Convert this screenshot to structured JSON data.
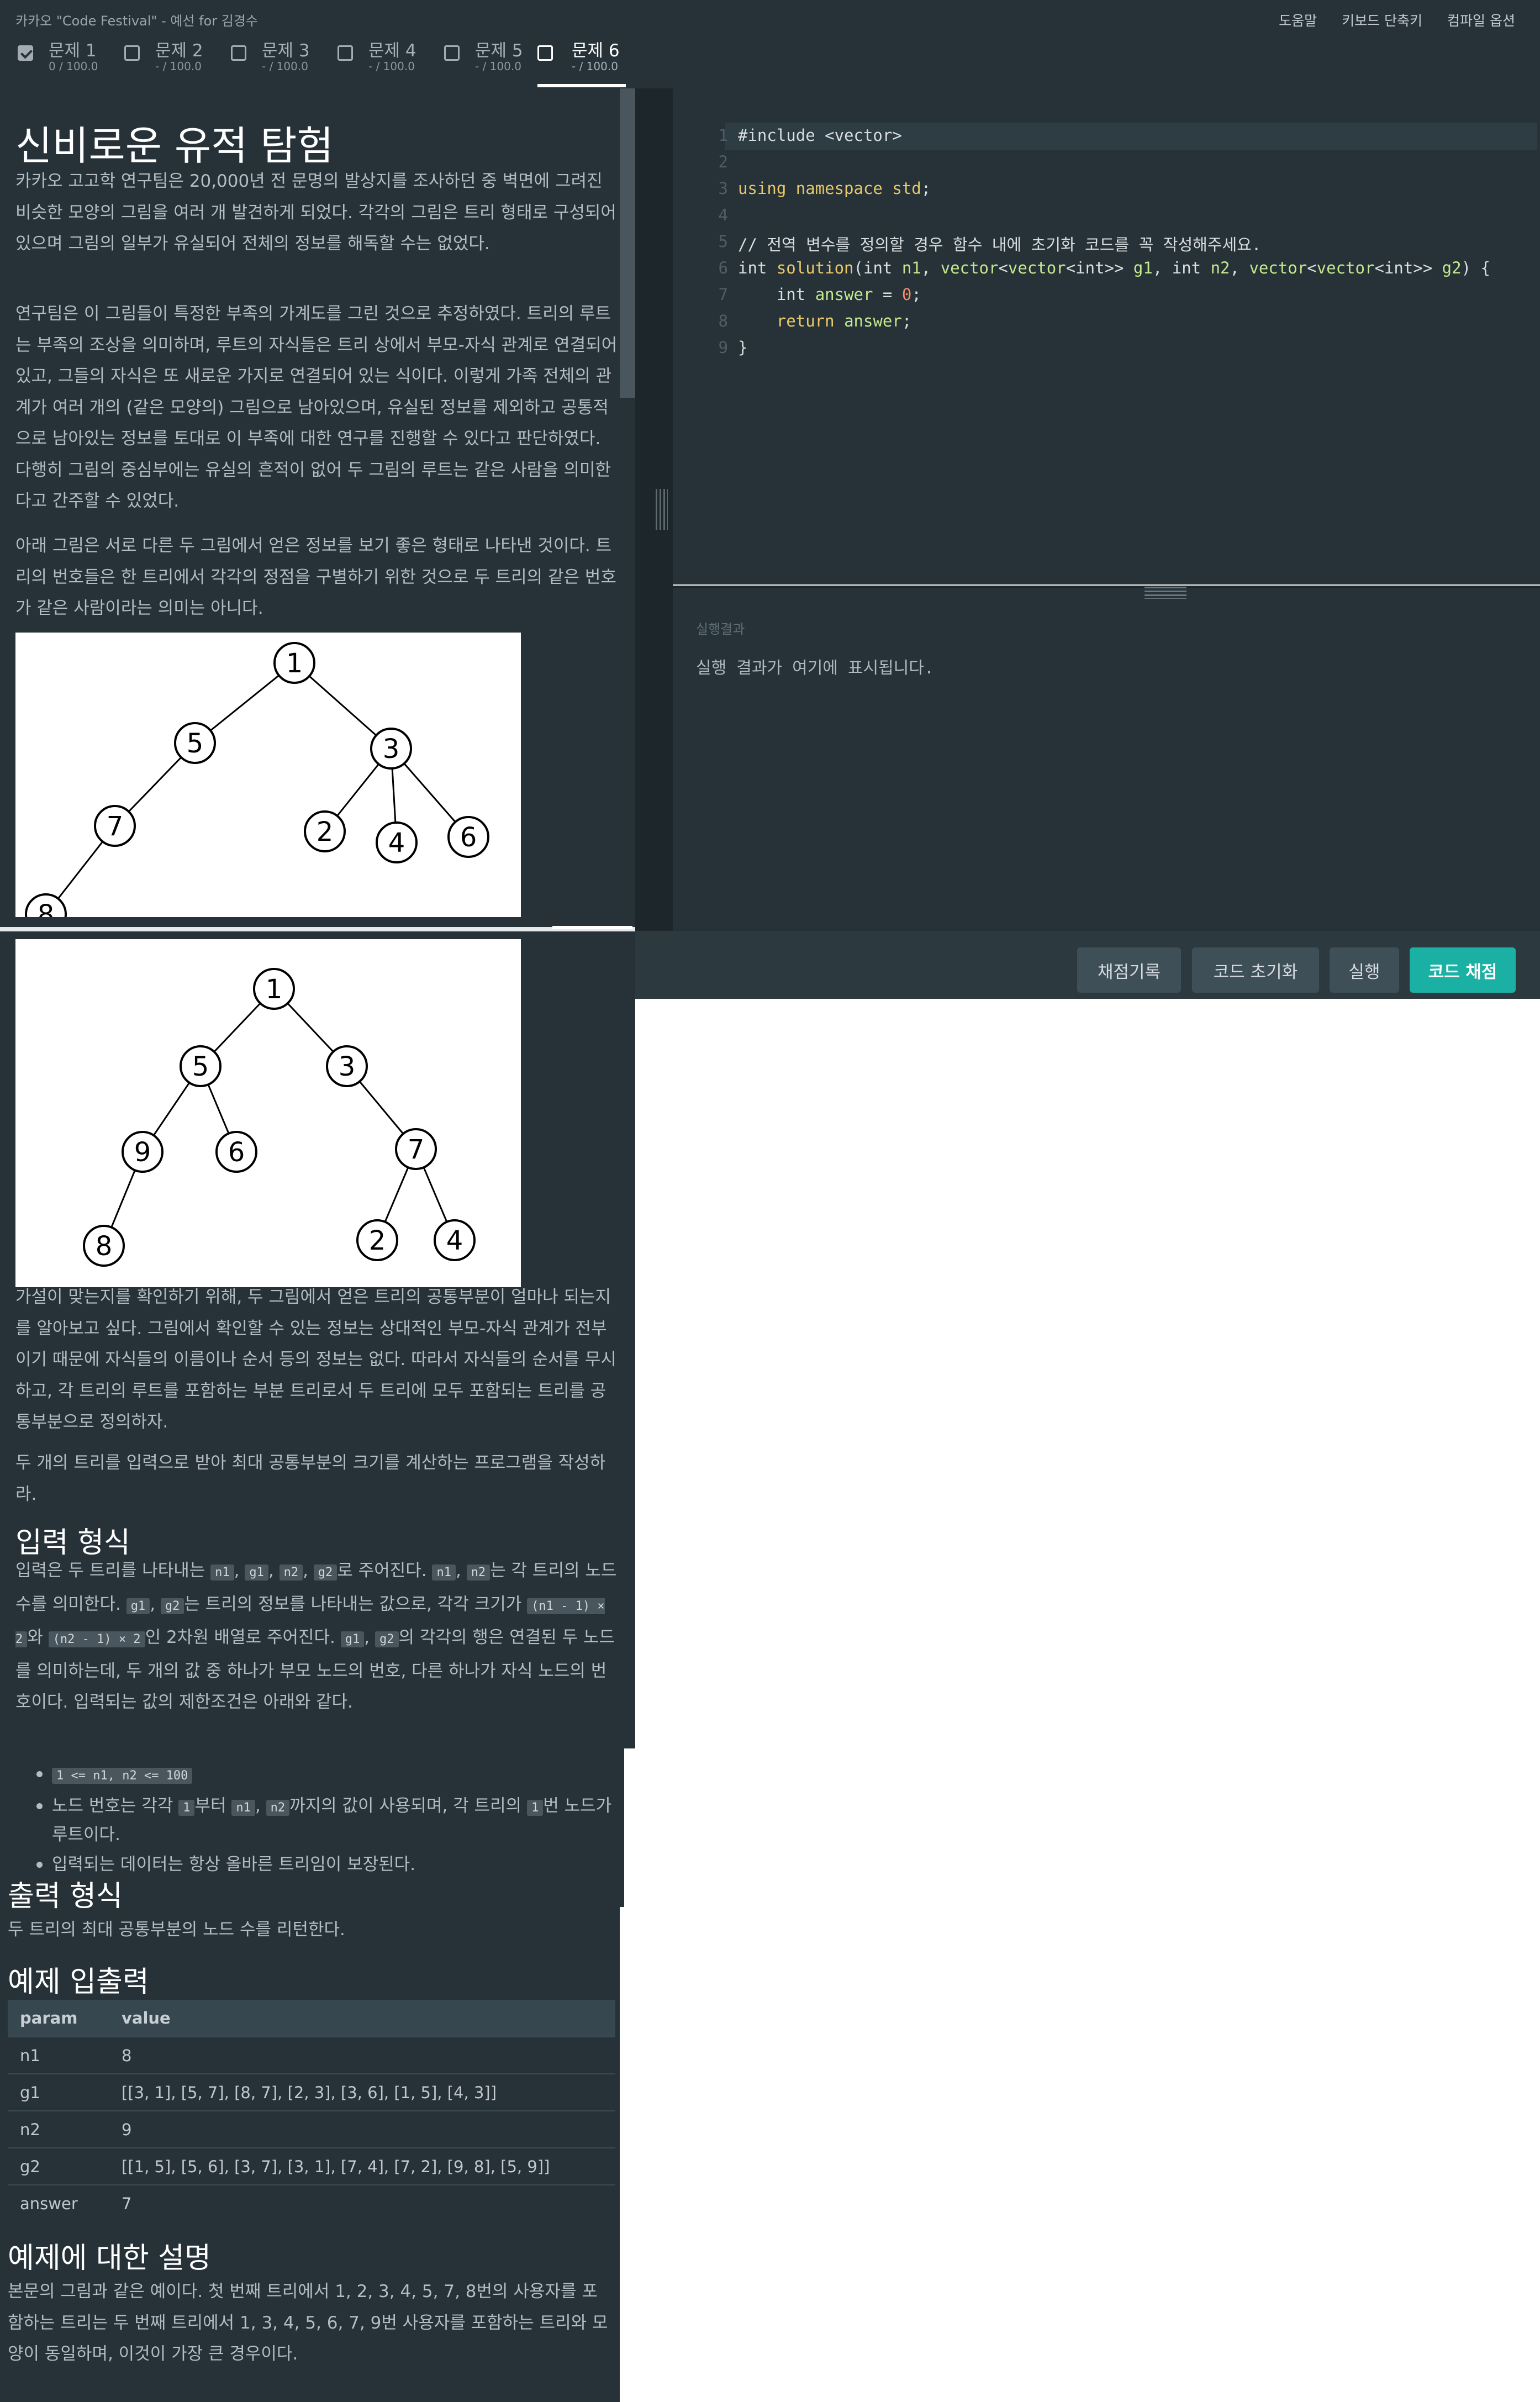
{
  "app": {
    "title": "카카오 \"Code Festival\" - 예선 for 김경수",
    "links": [
      "도움말",
      "키보드 단축키",
      "컴파일 옵션"
    ]
  },
  "tabs": [
    {
      "label": "문제 1",
      "score": "0 / 100.0",
      "checked": true
    },
    {
      "label": "문제 2",
      "score": "- / 100.0",
      "checked": false
    },
    {
      "label": "문제 3",
      "score": "- / 100.0",
      "checked": false
    },
    {
      "label": "문제 4",
      "score": "- / 100.0",
      "checked": false
    },
    {
      "label": "문제 5",
      "score": "- / 100.0",
      "checked": false
    },
    {
      "label": "문제 6",
      "score": "- / 100.0",
      "checked": false,
      "active": true
    }
  ],
  "problem": {
    "title": "신비로운 유적 탐험",
    "p1": "카카오 고고학 연구팀은 20,000년 전 문명의 발상지를 조사하던 중 벽면에 그려진 비슷한 모양의 그림을 여러 개 발견하게 되었다. 각각의 그림은 트리 형태로 구성되어 있으며 그림의 일부가 유실되어 전체의 정보를 해독할 수는 없었다.",
    "p2": "연구팀은 이 그림들이 특정한 부족의 가계도를 그린 것으로 추정하였다. 트리의 루트는 부족의 조상을 의미하며, 루트의 자식들은 트리 상에서 부모-자식 관계로 연결되어 있고, 그들의 자식은 또 새로운 가지로 연결되어 있는 식이다. 이렇게 가족 전체의 관계가 여러 개의 (같은 모양의) 그림으로 남아있으며, 유실된 정보를 제외하고 공통적으로 남아있는 정보를 토대로 이 부족에 대한 연구를 진행할 수 있다고 판단하였다. 다행히 그림의 중심부에는 유실의 흔적이 없어 두 그림의 루트는 같은 사람을 의미한다고 간주할 수 있었다.",
    "p3": "아래 그림은 서로 다른 두 그림에서 얻은 정보를 보기 좋은 형태로 나타낸 것이다. 트리의 번호들은 한 트리에서 각각의 정점을 구별하기 위한 것으로 두 트리의 같은 번호가 같은 사람이라는 의미는 아니다.",
    "p4": "가설이 맞는지를 확인하기 위해, 두 그림에서 얻은 트리의 공통부분이 얼마나 되는지를 알아보고 싶다. 그림에서 확인할 수 있는 정보는 상대적인 부모-자식 관계가 전부이기 때문에 자식들의 이름이나 순서 등의 정보는 없다. 따라서 자식들의 순서를 무시하고, 각 트리의 루트를 포함하는 부분 트리로서 두 트리에 모두 포함되는 트리를 공통부분으로 정의하자.",
    "p5": "두 개의 트리를 입력으로 받아 최대 공통부분의 크기를 계산하는 프로그램을 작성하라.",
    "tree1_nodes": [
      "1",
      "5",
      "3",
      "7",
      "2",
      "4",
      "6",
      "8"
    ],
    "tree2_nodes": [
      "1",
      "5",
      "3",
      "9",
      "6",
      "7",
      "8",
      "2",
      "4"
    ]
  },
  "input_section": {
    "heading": "입력 형식",
    "t1": "입력은 두 트리를 나타내는 ",
    "c_n1": "n1",
    "c_g1": "g1",
    "c_n2": "n2",
    "c_g2": "g2",
    "sep": ", ",
    "t2": "로 주어진다. ",
    "t3": "는 각 트리의 노드 수를 의미한다. ",
    "t4": "는 트리의 정보를 나타내는 값으로, 각각 크기가 ",
    "c_size1": "(n1 - 1) × 2",
    "t5": "와 ",
    "c_size2": "(n2 - 1) × 2",
    "t6": "인 2차원 배열로 주어진다. ",
    "t7": "의 각각의 행은 연결된 두 노드를 의미하는데, 두 개의 값 중 하나가 부모 노드의 번호, 다른 하나가 자식 노드의 번호이다. 입력되는 값의 제한조건은 아래와 같다.",
    "b1_code": "1 <= n1, n2 <= 100",
    "b2_t1": "노드 번호는 각각 ",
    "b2_c1": "1",
    "b2_t2": "부터 ",
    "b2_t3": "까지의 값이 사용되며, 각 트리의 ",
    "b2_t4": "번 노드가 루트이다.",
    "b3": "입력되는 데이터는 항상 올바른 트리임이 보장된다."
  },
  "output_section": {
    "heading": "출력 형식",
    "text": "두 트리의 최대 공통부분의 노드 수를 리턴한다."
  },
  "examples": {
    "heading": "예제 입출력",
    "columns": [
      "param",
      "value"
    ],
    "rows": [
      [
        "n1",
        "8"
      ],
      [
        "g1",
        "[[3, 1], [5, 7], [8, 7], [2, 3], [3, 6], [1, 5], [4, 3]]"
      ],
      [
        "n2",
        "9"
      ],
      [
        "g2",
        "[[1, 5], [5, 6], [3, 7], [3, 1], [7, 4], [7, 2], [9, 8], [5, 9]]"
      ],
      [
        "answer",
        "7"
      ]
    ]
  },
  "explanation": {
    "heading": "예제에 대한 설명",
    "text": "본문의 그림과 같은 예이다. 첫 번째 트리에서 1, 2, 3, 4, 5, 7, 8번의 사용자를 포함하는 트리는 두 번째 트리에서 1, 3, 4, 5, 6, 7, 9번 사용자를 포함하는 트리와 모양이 동일하며, 이것이 가장 큰 경우이다."
  },
  "editor": {
    "line_numbers": [
      "1",
      "2",
      "3",
      "4",
      "5",
      "6",
      "7",
      "8",
      "9"
    ],
    "l1": "#include <vector>",
    "l3_kw": "using namespace",
    "l3_ns": "std",
    "l3_end": ";",
    "l5": "// 전역 변수를 정의할 경우 함수 내에 초기화 코드를 꼭 작성해주세요.",
    "l6_a": "int ",
    "l6_fn": "solution",
    "l6_b": "(int ",
    "l6_n1": "n1",
    "l6_c": ", ",
    "l6_vec1": "vector",
    "l6_d": "<",
    "l6_vec2": "vector",
    "l6_e": "<int>> ",
    "l6_g1": "g1",
    "l6_f": ", int ",
    "l6_n2": "n2",
    "l6_g": ", ",
    "l6_vec3": "vector",
    "l6_h": "<",
    "l6_vec4": "vector",
    "l6_i": "<int>> ",
    "l6_g2": "g2",
    "l6_j": ") {",
    "l7_a": "    int ",
    "l7_var": "answer",
    "l7_b": " = ",
    "l7_num": "0",
    "l7_c": ";",
    "l8_kw": "    return",
    "l8_var": " answer",
    "l8_end": ";",
    "l9": "}"
  },
  "output_panel": {
    "label": "실행결과",
    "text": "실행 결과가 여기에 표시됩니다."
  },
  "actions": {
    "history": "채점기록",
    "reset": "코드 초기화",
    "run": "실행",
    "submit": "코드 채점"
  },
  "colors": {
    "panel_bg": "#263238",
    "accent": "#1bb0a4",
    "comment": "#f07178",
    "keyword": "#e8c86a",
    "string_var": "#c3e88d"
  }
}
